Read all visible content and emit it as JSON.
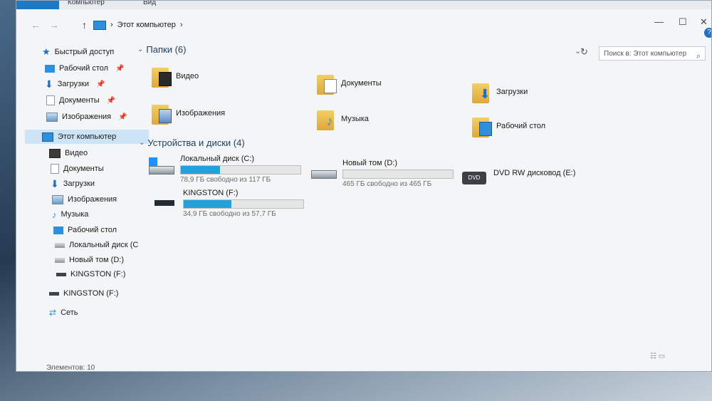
{
  "ribbon": {
    "tab_computer": "Компьютер",
    "tab_view": "Вид"
  },
  "window_controls": {
    "minimize": "—",
    "maximize": "☐",
    "close": "✕"
  },
  "address": {
    "back": "←",
    "forward": "→",
    "up": "↑",
    "path_root": "Этот компьютер",
    "sep": "›"
  },
  "search": {
    "placeholder": "Поиск в: Этот компьютер",
    "icon": "⌕"
  },
  "help_label": "?",
  "sidebar": {
    "items": [
      {
        "label": "Быстрый доступ",
        "icon": "star-icon"
      },
      {
        "label": "Рабочий стол",
        "icon": "desktop-icon",
        "pinned": true
      },
      {
        "label": "Загрузки",
        "icon": "download-icon",
        "pinned": true
      },
      {
        "label": "Документы",
        "icon": "documents-icon",
        "pinned": true
      },
      {
        "label": "Изображения",
        "icon": "pictures-icon",
        "pinned": true
      },
      {
        "label": "Этот компьютер",
        "icon": "computer-icon",
        "selected": true
      },
      {
        "label": "Видео",
        "icon": "video-icon"
      },
      {
        "label": "Документы",
        "icon": "documents-icon"
      },
      {
        "label": "Загрузки",
        "icon": "download-icon"
      },
      {
        "label": "Изображения",
        "icon": "pictures-icon"
      },
      {
        "label": "Музыка",
        "icon": "music-icon"
      },
      {
        "label": "Рабочий стол",
        "icon": "desktop-icon"
      },
      {
        "label": "Локальный диск (C",
        "icon": "drive-icon"
      },
      {
        "label": "Новый том (D:)",
        "icon": "drive-icon"
      },
      {
        "label": "KINGSTON (F:)",
        "icon": "usb-icon"
      },
      {
        "label": "KINGSTON (F:)",
        "icon": "usb-icon"
      },
      {
        "label": "Сеть",
        "icon": "network-icon"
      }
    ],
    "pin_glyph": "📌"
  },
  "folders_group": {
    "title": "Папки (6)"
  },
  "folders": [
    {
      "label": "Видео",
      "icon": "video-folder-icon"
    },
    {
      "label": "Документы",
      "icon": "documents-folder-icon"
    },
    {
      "label": "Загрузки",
      "icon": "downloads-folder-icon"
    },
    {
      "label": "Изображения",
      "icon": "pictures-folder-icon"
    },
    {
      "label": "Музыка",
      "icon": "music-folder-icon"
    },
    {
      "label": "Рабочий стол",
      "icon": "desktop-folder-icon"
    }
  ],
  "drives_group": {
    "title": "Устройства и диски (4)"
  },
  "drives": [
    {
      "name": "Локальный диск (C:)",
      "free": "78,9 ГБ свободно из 117 ГБ",
      "used_fraction": 0.33,
      "icon": "windows-drive-icon"
    },
    {
      "name": "Новый том (D:)",
      "free": "465 ГБ свободно из 465 ГБ",
      "used_fraction": 0.0,
      "icon": "hdd-icon"
    },
    {
      "name": "DVD RW дисковод (E:)",
      "icon": "dvd-drive-icon"
    },
    {
      "name": "KINGSTON (F:)",
      "free": "34,9 ГБ свободно из 57,7 ГБ",
      "used_fraction": 0.4,
      "icon": "usb-drive-icon"
    }
  ],
  "dvd_badge": "DVD",
  "status": {
    "items": "Элементов: 10"
  },
  "colors": {
    "accent": "#26a0da",
    "folder": "#f3cf65",
    "selection": "#cde4f7"
  }
}
